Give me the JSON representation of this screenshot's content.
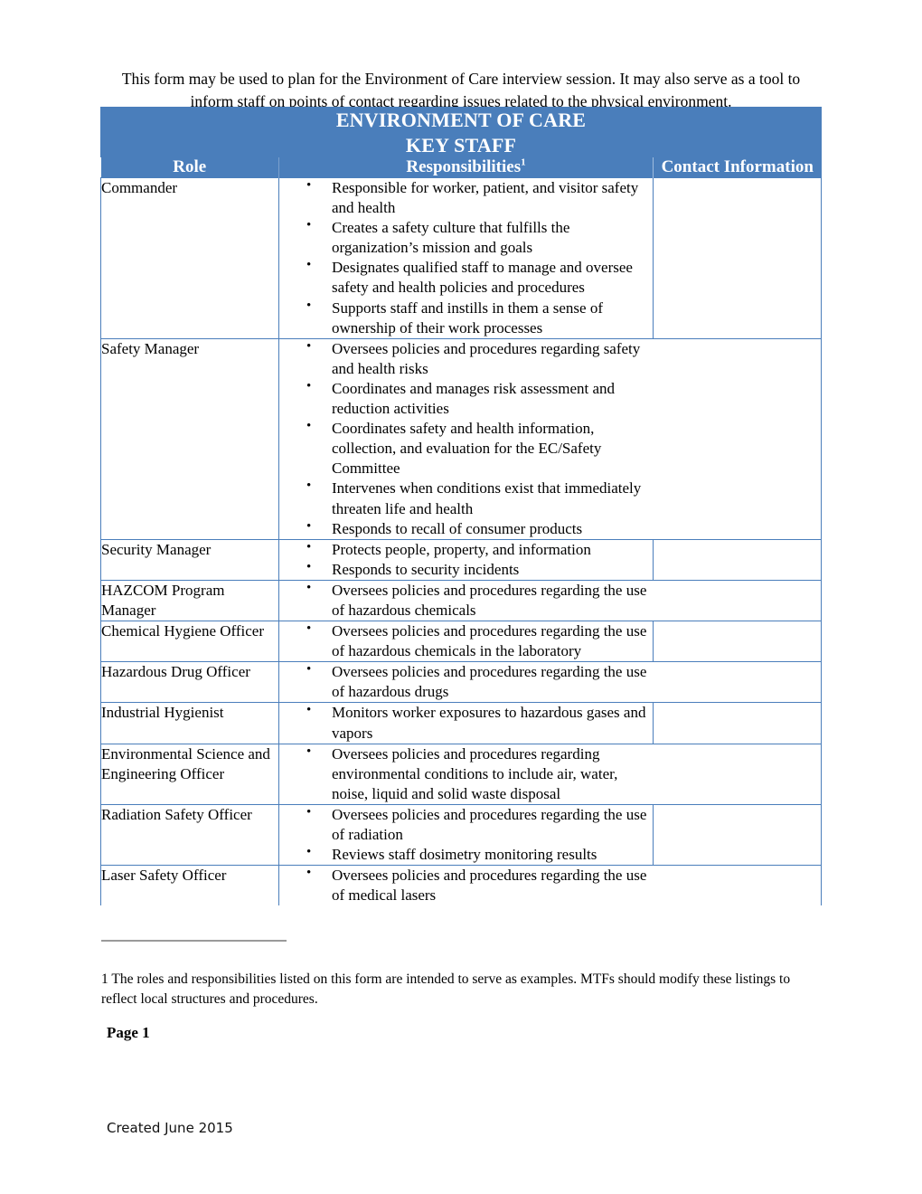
{
  "document": {
    "intro": "This form may be used to plan for the Environment of Care interview session.  It may also serve as a tool to inform staff on points of contact regarding issues related to the physical environment.",
    "page_label": "Page 1",
    "footer_text": "Created June 2015",
    "footnote_marker": "1",
    "footnote_text": "  The roles and responsibilities listed on this form are intended to serve as examples.  MTFs should modify these listings to reflect local structures and procedures."
  },
  "colors": {
    "table_blue": "#4a7ebb",
    "header_text": "#ffffff",
    "footnote_rule": "#9a9a9a"
  },
  "table": {
    "title_line1": "ENVIRONMENT OF CARE",
    "title_line2": "KEY STAFF",
    "columns": {
      "role": "Role",
      "responsibilities": "Responsibilities",
      "responsibilities_superscript": "1",
      "contact": "Contact Information"
    },
    "rows": [
      {
        "role": "Commander",
        "responsibilities": [
          "Responsible for worker, patient, and visitor safety and health",
          "Creates a safety culture that fulfills the organization’s mission and goals",
          "Designates qualified staff to manage and oversee safety and health policies and procedures",
          "Supports staff and instills in them a sense of ownership of their work processes"
        ],
        "contact": "",
        "divider": true
      },
      {
        "role": "Safety Manager",
        "responsibilities": [
          "Oversees policies and procedures regarding safety and health risks",
          "Coordinates and manages risk assessment and reduction activities",
          "Coordinates safety and health information, collection, and evaluation for the EC/Safety Committee",
          "Intervenes when conditions exist that immediately threaten life and health",
          "Responds to recall of consumer products"
        ],
        "contact": "",
        "divider": false
      },
      {
        "role": "Security Manager",
        "responsibilities": [
          "Protects people, property, and information",
          "Responds to security incidents"
        ],
        "contact": "",
        "divider": true
      },
      {
        "role": "HAZCOM Program Manager",
        "responsibilities": [
          "Oversees policies and procedures regarding the use of hazardous chemicals"
        ],
        "contact": "",
        "divider": false
      },
      {
        "role": "Chemical Hygiene Officer",
        "responsibilities": [
          "Oversees policies and procedures regarding the use of hazardous chemicals in the laboratory"
        ],
        "contact": "",
        "divider": true
      },
      {
        "role": "Hazardous Drug Officer",
        "responsibilities": [
          "Oversees policies and procedures regarding the use of hazardous drugs"
        ],
        "contact": "",
        "divider": false
      },
      {
        "role": "Industrial Hygienist",
        "responsibilities": [
          "Monitors worker exposures to hazardous gases and vapors"
        ],
        "contact": "",
        "divider": true
      },
      {
        "role": "Environmental Science and Engineering Officer",
        "responsibilities": [
          "Oversees policies and procedures regarding environmental conditions to include air, water, noise, liquid and solid waste disposal"
        ],
        "contact": "",
        "divider": false
      },
      {
        "role": "Radiation Safety Officer",
        "responsibilities": [
          "Oversees policies and procedures regarding the use of radiation",
          "Reviews staff dosimetry monitoring results"
        ],
        "contact": "",
        "divider": true
      },
      {
        "role": "Laser Safety Officer",
        "responsibilities": [
          "Oversees policies and procedures regarding the use of medical lasers"
        ],
        "contact": "",
        "divider": false,
        "clipped": true
      }
    ]
  }
}
